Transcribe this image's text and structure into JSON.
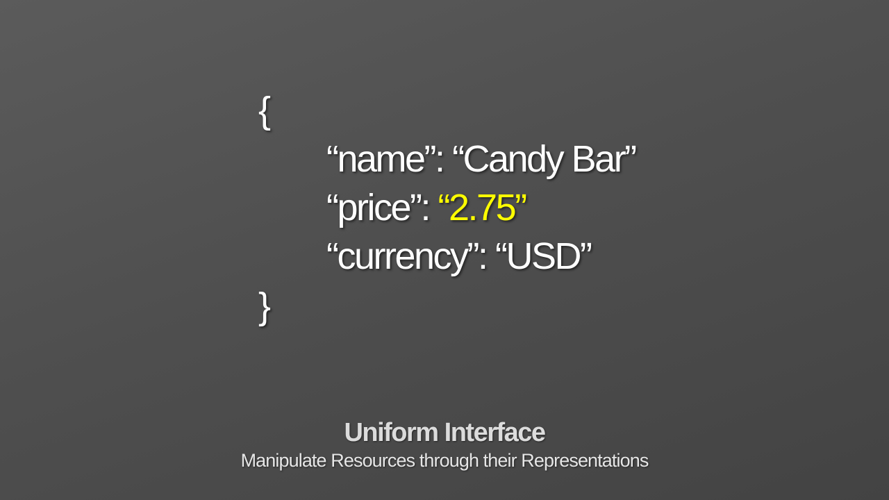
{
  "code": {
    "open_brace": "{",
    "close_brace": "}",
    "lines": [
      {
        "key": "“name”",
        "separator": ": ",
        "value": "“Candy Bar”"
      },
      {
        "key": "“price”",
        "separator": ": ",
        "value": "“2.75”"
      },
      {
        "key": "“currency”",
        "separator": ": ",
        "value": "“USD”"
      }
    ],
    "highlight_color": "#ffff00"
  },
  "caption": {
    "title": "Uniform Interface",
    "subtitle": "Manipulate Resources through their Representations"
  },
  "colors": {
    "background_light": "#5b5b5b",
    "background_dark": "#434343",
    "text": "#ffffff"
  }
}
